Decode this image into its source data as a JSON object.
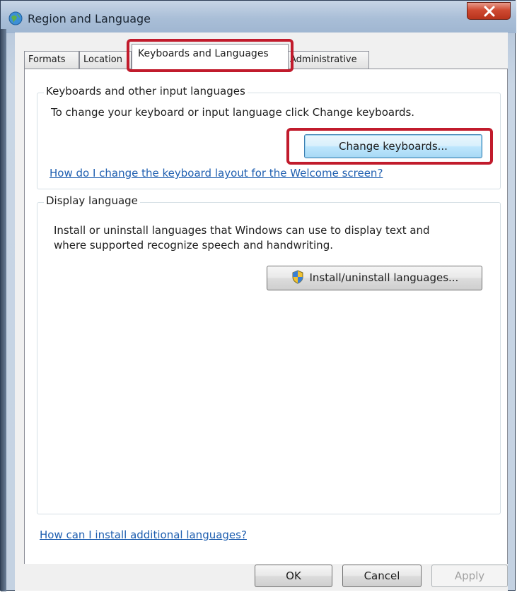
{
  "window": {
    "title": "Region and Language"
  },
  "tabs": [
    {
      "label": "Formats",
      "active": false
    },
    {
      "label": "Location",
      "active": false
    },
    {
      "label": "Keyboards and Languages",
      "active": true
    },
    {
      "label": "Administrative",
      "active": false
    }
  ],
  "keyboards_group": {
    "title": "Keyboards and other input languages",
    "description": "To change your keyboard or input language click Change keyboards.",
    "change_button": "Change keyboards...",
    "welcome_link": "How do I change the keyboard layout for the Welcome screen?"
  },
  "display_group": {
    "title": "Display language",
    "description_line1": "Install or uninstall languages that Windows can use to display text and",
    "description_line2": "where supported recognize speech and handwriting.",
    "install_button": "Install/uninstall languages..."
  },
  "footer_link": "How can I install additional languages?",
  "buttons": {
    "ok": "OK",
    "cancel": "Cancel",
    "apply": "Apply"
  },
  "colors": {
    "highlight": "#c11b2c",
    "link": "#1f5fb0"
  }
}
